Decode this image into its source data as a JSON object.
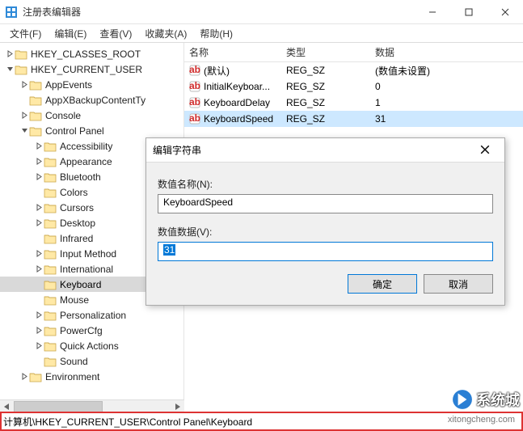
{
  "window": {
    "title": "注册表编辑器"
  },
  "menubar": {
    "items": [
      "文件(F)",
      "编辑(E)",
      "查看(V)",
      "收藏夹(A)",
      "帮助(H)"
    ]
  },
  "tree": {
    "nodes": [
      {
        "depth": 0,
        "twisty": "right",
        "label": "HKEY_CLASSES_ROOT",
        "selected": false
      },
      {
        "depth": 0,
        "twisty": "down",
        "label": "HKEY_CURRENT_USER",
        "selected": false
      },
      {
        "depth": 1,
        "twisty": "right",
        "label": "AppEvents",
        "selected": false
      },
      {
        "depth": 1,
        "twisty": "none",
        "label": "AppXBackupContentTy",
        "selected": false
      },
      {
        "depth": 1,
        "twisty": "right",
        "label": "Console",
        "selected": false
      },
      {
        "depth": 1,
        "twisty": "down",
        "label": "Control Panel",
        "selected": false
      },
      {
        "depth": 2,
        "twisty": "right",
        "label": "Accessibility",
        "selected": false
      },
      {
        "depth": 2,
        "twisty": "right",
        "label": "Appearance",
        "selected": false
      },
      {
        "depth": 2,
        "twisty": "right",
        "label": "Bluetooth",
        "selected": false
      },
      {
        "depth": 2,
        "twisty": "none",
        "label": "Colors",
        "selected": false
      },
      {
        "depth": 2,
        "twisty": "right",
        "label": "Cursors",
        "selected": false
      },
      {
        "depth": 2,
        "twisty": "right",
        "label": "Desktop",
        "selected": false
      },
      {
        "depth": 2,
        "twisty": "none",
        "label": "Infrared",
        "selected": false
      },
      {
        "depth": 2,
        "twisty": "right",
        "label": "Input Method",
        "selected": false
      },
      {
        "depth": 2,
        "twisty": "right",
        "label": "International",
        "selected": false
      },
      {
        "depth": 2,
        "twisty": "none",
        "label": "Keyboard",
        "selected": true
      },
      {
        "depth": 2,
        "twisty": "none",
        "label": "Mouse",
        "selected": false
      },
      {
        "depth": 2,
        "twisty": "right",
        "label": "Personalization",
        "selected": false
      },
      {
        "depth": 2,
        "twisty": "right",
        "label": "PowerCfg",
        "selected": false
      },
      {
        "depth": 2,
        "twisty": "right",
        "label": "Quick Actions",
        "selected": false
      },
      {
        "depth": 2,
        "twisty": "none",
        "label": "Sound",
        "selected": false
      },
      {
        "depth": 1,
        "twisty": "right",
        "label": "Environment",
        "selected": false
      }
    ]
  },
  "list": {
    "columns": {
      "name": "名称",
      "type": "类型",
      "data": "数据"
    },
    "rows": [
      {
        "name": "(默认)",
        "type": "REG_SZ",
        "data": "(数值未设置)",
        "selected": false
      },
      {
        "name": "InitialKeyboar...",
        "type": "REG_SZ",
        "data": "0",
        "selected": false
      },
      {
        "name": "KeyboardDelay",
        "type": "REG_SZ",
        "data": "1",
        "selected": false
      },
      {
        "name": "KeyboardSpeed",
        "type": "REG_SZ",
        "data": "31",
        "selected": true
      }
    ]
  },
  "dialog": {
    "title": "编辑字符串",
    "name_label": "数值名称(N):",
    "name_value": "KeyboardSpeed",
    "data_label": "数值数据(V):",
    "data_value": "31",
    "ok": "确定",
    "cancel": "取消"
  },
  "statusbar": {
    "path": "计算机\\HKEY_CURRENT_USER\\Control Panel\\Keyboard"
  },
  "watermark": {
    "text": "系统城",
    "url": "xitongcheng.com"
  }
}
